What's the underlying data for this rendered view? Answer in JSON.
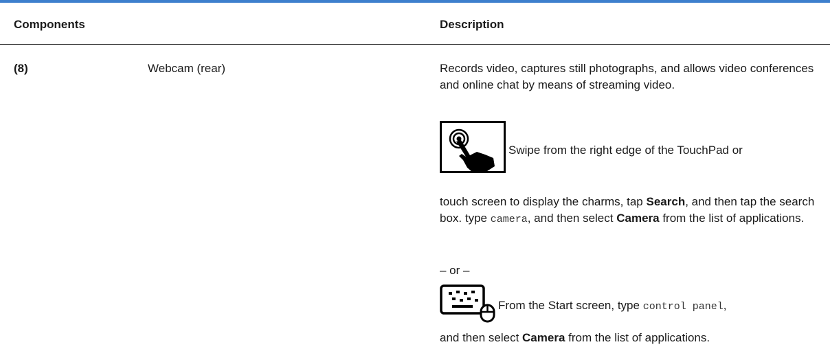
{
  "table": {
    "headers": {
      "components": "Components",
      "description": "Description"
    },
    "row": {
      "number": "(8)",
      "name": "Webcam (rear)",
      "intro": "Records video, captures still photographs, and allows video conferences and online chat by means of streaming video.",
      "touch": {
        "icon": "touch-swipe-icon",
        "lead": "Swipe from the right edge of the TouchPad or",
        "tail_1": "touch screen to display the charms, tap ",
        "search_label": "Search",
        "tail_2": ", and then tap the search box. type ",
        "typed": "camera",
        "tail_3": ", and then select ",
        "camera_label": "Camera",
        "tail_4": " from the list of applications."
      },
      "or_separator": "– or –",
      "keyboard": {
        "icon": "keyboard-mouse-icon",
        "lead": "From the Start screen, type ",
        "typed": "control panel",
        "lead_end": ",",
        "tail_1": "and then select ",
        "camera_label": "Camera",
        "tail_2": " from the list of applications."
      }
    }
  },
  "colors": {
    "top_rule": "#3d7fcd",
    "header_rule": "#222222",
    "text": "#1a1a1a"
  }
}
